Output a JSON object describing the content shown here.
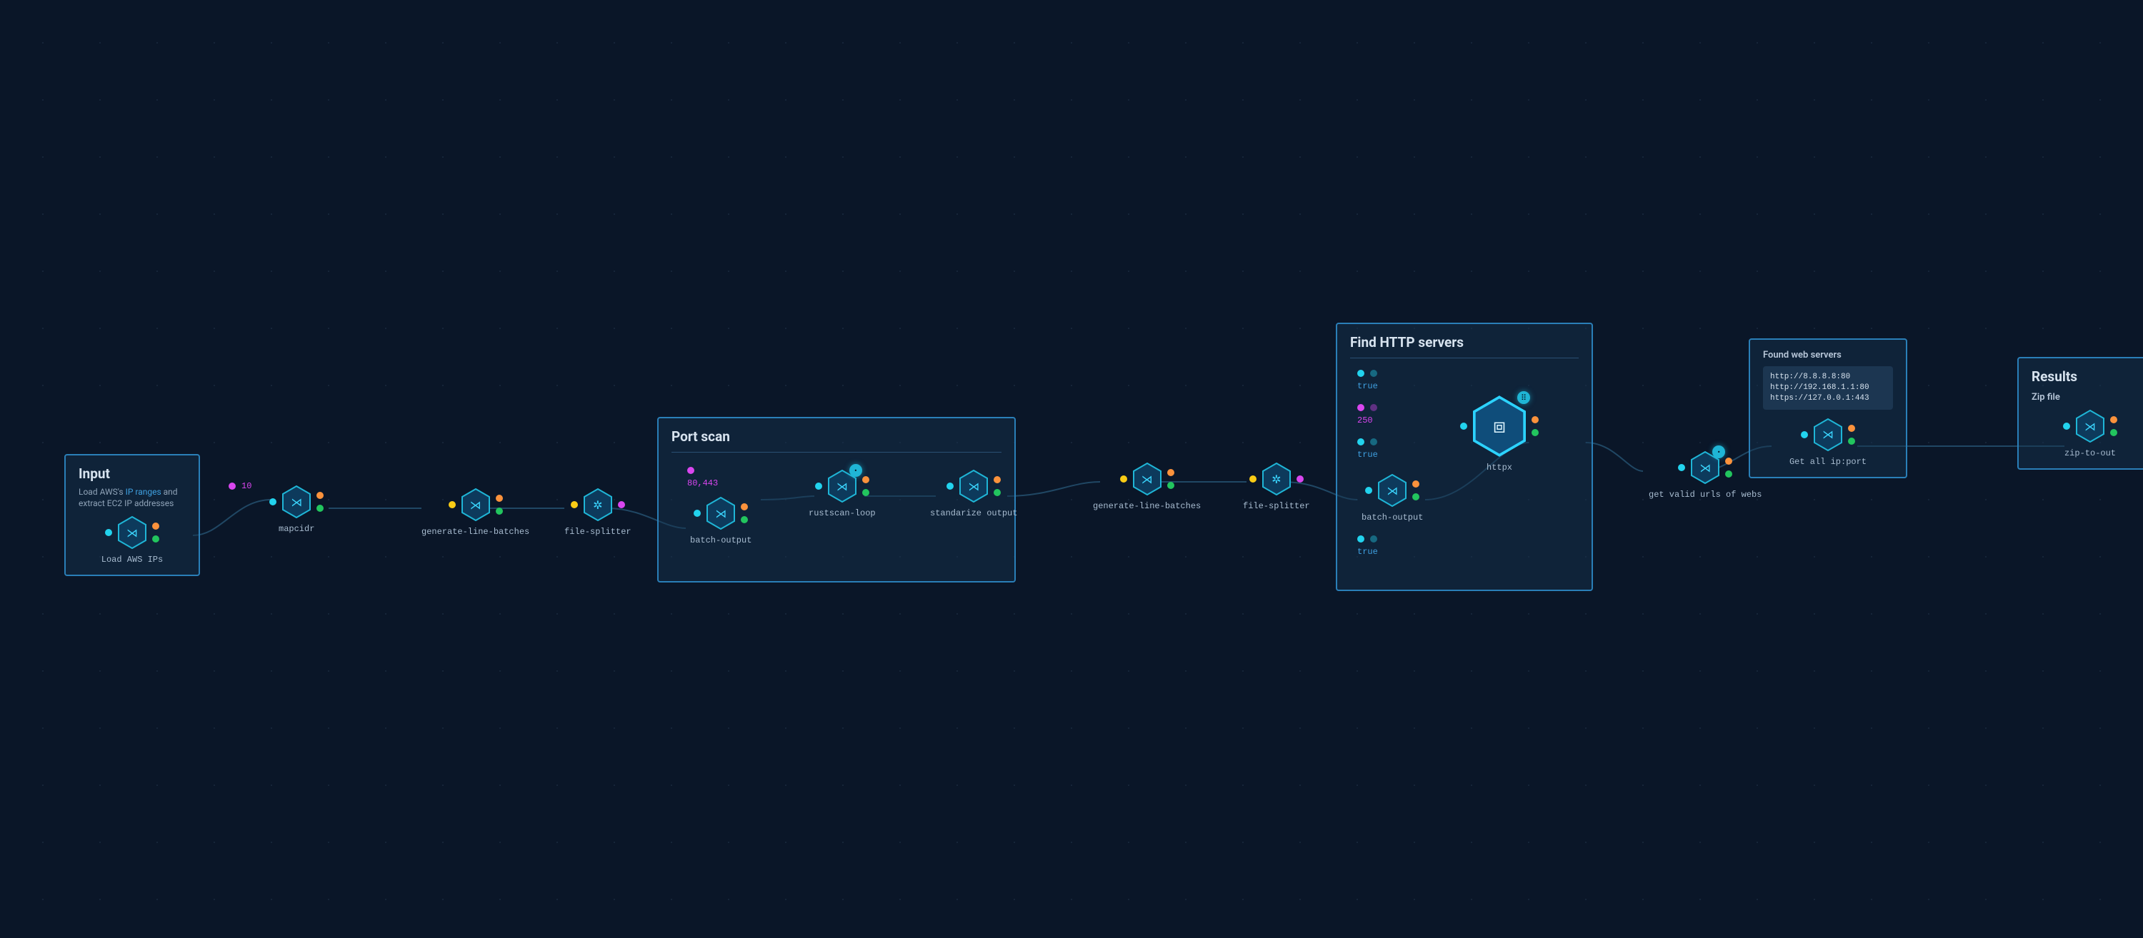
{
  "colors": {
    "bg": "#0a1628",
    "panel_bg": "rgba(23,50,77,0.45)",
    "panel_border": "#2a7fb8",
    "accent": "#3fa0e0",
    "glyph": "#3bd6ff"
  },
  "port_types": {
    "pink": "number-param",
    "cyan": "stream",
    "orange": "file",
    "yellow": "text",
    "green": "success"
  },
  "groups": {
    "input": {
      "title": "Input",
      "desc_prefix": "Load AWS's ",
      "desc_link": "IP ranges",
      "desc_suffix": " and extract EC2 IP addresses",
      "node_label": "Load AWS IPs"
    },
    "port_scan": {
      "title": "Port scan",
      "batch_ports": "80,443",
      "nodes": {
        "batch_output": "batch-output",
        "rustscan_loop": "rustscan-loop",
        "standarize_output": "standarize output"
      }
    },
    "find_http": {
      "title": "Find HTTP servers",
      "params": {
        "p1": "true",
        "p2": "250",
        "p3": "true",
        "p4": "true"
      },
      "nodes": {
        "batch_output": "batch-output",
        "httpx": "httpx"
      }
    },
    "found_web": {
      "title": "Found web servers",
      "code": "http://8.8.8.8:80\nhttp://192.168.1.1:80\nhttps://127.0.0.1:443",
      "node_label": "Get all ip:port"
    },
    "results": {
      "title": "Results",
      "subtitle": "Zip file",
      "node_label": "zip-to-out"
    }
  },
  "free_nodes": {
    "mapcidr": {
      "label": "mapcidr",
      "param": "10"
    },
    "glb1": {
      "label": "generate-line-batches"
    },
    "fs1": {
      "label": "file-splitter"
    },
    "glb2": {
      "label": "generate-line-batches"
    },
    "fs2": {
      "label": "file-splitter"
    },
    "valid_urls": {
      "label": "get valid urls of webs"
    }
  }
}
